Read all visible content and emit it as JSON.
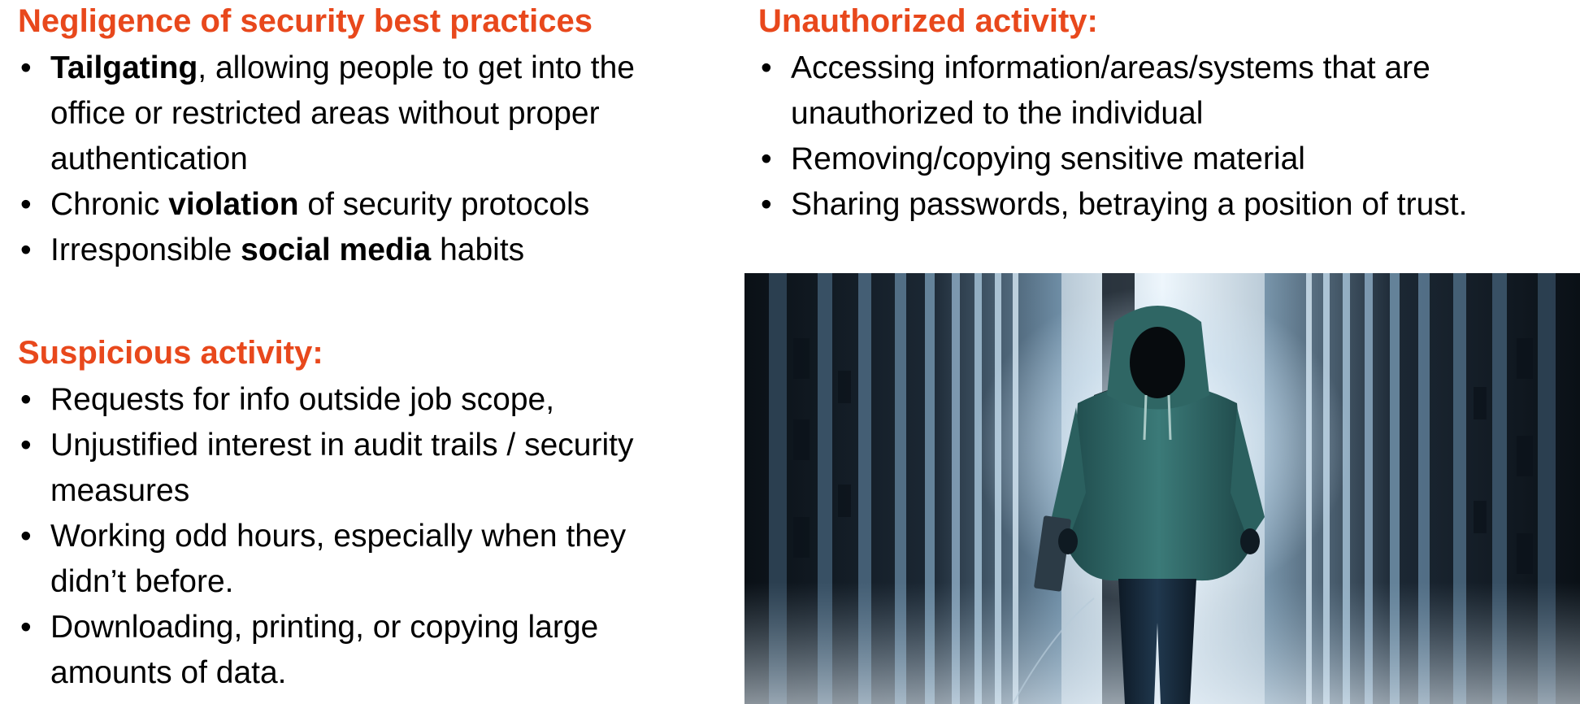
{
  "colors": {
    "heading": "#e8481c",
    "text": "#000000",
    "background": "#ffffff"
  },
  "negligence": {
    "heading": "Negligence of security best practices",
    "items": [
      {
        "bold": "Tailgating",
        "text": ", allowing people to get into the office or restricted areas without proper authentication"
      },
      {
        "pre": "Chronic ",
        "bold": "violation",
        "post": " of security protocols"
      },
      {
        "pre": "Irresponsible ",
        "bold": "social media",
        "post": " habits"
      }
    ]
  },
  "suspicious": {
    "heading": "Suspicious activity:",
    "items": [
      "Requests for info outside job scope,",
      "Unjustified interest in audit trails / security measures",
      "Working odd hours, especially when they didn’t before.",
      "Downloading, printing, or copying large amounts of data."
    ]
  },
  "unauthorized": {
    "heading": "Unauthorized activity:",
    "items": [
      "Accessing information/areas/systems that are unauthorized to the individual",
      "Removing/copying sensitive material",
      "Sharing passwords, betraying a position of trust."
    ]
  },
  "photo": {
    "icon": "hooded-figure-in-server-corridor"
  }
}
